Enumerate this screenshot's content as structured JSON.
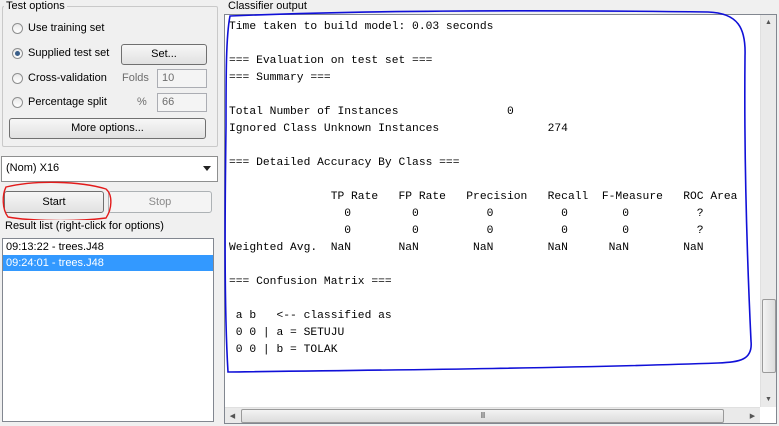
{
  "test_options": {
    "title": "Test options",
    "use_training_set": "Use training set",
    "supplied_test_set": "Supplied test set",
    "set_button": "Set...",
    "cross_validation": "Cross-validation",
    "folds_label": "Folds",
    "folds_value": "10",
    "percentage_split": "Percentage split",
    "percent_label": "%",
    "percent_value": "66",
    "more_options": "More options...",
    "selected": "supplied_test_set"
  },
  "class_selector": {
    "value": "(Nom) X16"
  },
  "controls": {
    "start": "Start",
    "stop": "Stop"
  },
  "result_list": {
    "title": "Result list (right-click for options)",
    "items": [
      {
        "label": "09:13:22 - trees.J48",
        "selected": false
      },
      {
        "label": "09:24:01 - trees.J48",
        "selected": true
      }
    ]
  },
  "classifier_output": {
    "title": "Classifier output",
    "lines": [
      "Time taken to build model: 0.03 seconds",
      "",
      "=== Evaluation on test set ===",
      "=== Summary ===",
      "",
      "Total Number of Instances                0",
      "Ignored Class Unknown Instances                274",
      "",
      "=== Detailed Accuracy By Class ===",
      "",
      "               TP Rate   FP Rate   Precision   Recall  F-Measure   ROC Area",
      "                 0         0          0          0        0          ?",
      "                 0         0          0          0        0          ?",
      "Weighted Avg.  NaN       NaN        NaN        NaN      NaN        NaN",
      "",
      "=== Confusion Matrix ===",
      "",
      " a b   <-- classified as",
      " 0 0 | a = SETUJU",
      " 0 0 | b = TOLAK"
    ]
  },
  "scrollbar": {
    "h_thumb_grip": "III"
  },
  "annotations": {
    "color_red": "#e31b1b",
    "color_blue": "#1010d8"
  }
}
